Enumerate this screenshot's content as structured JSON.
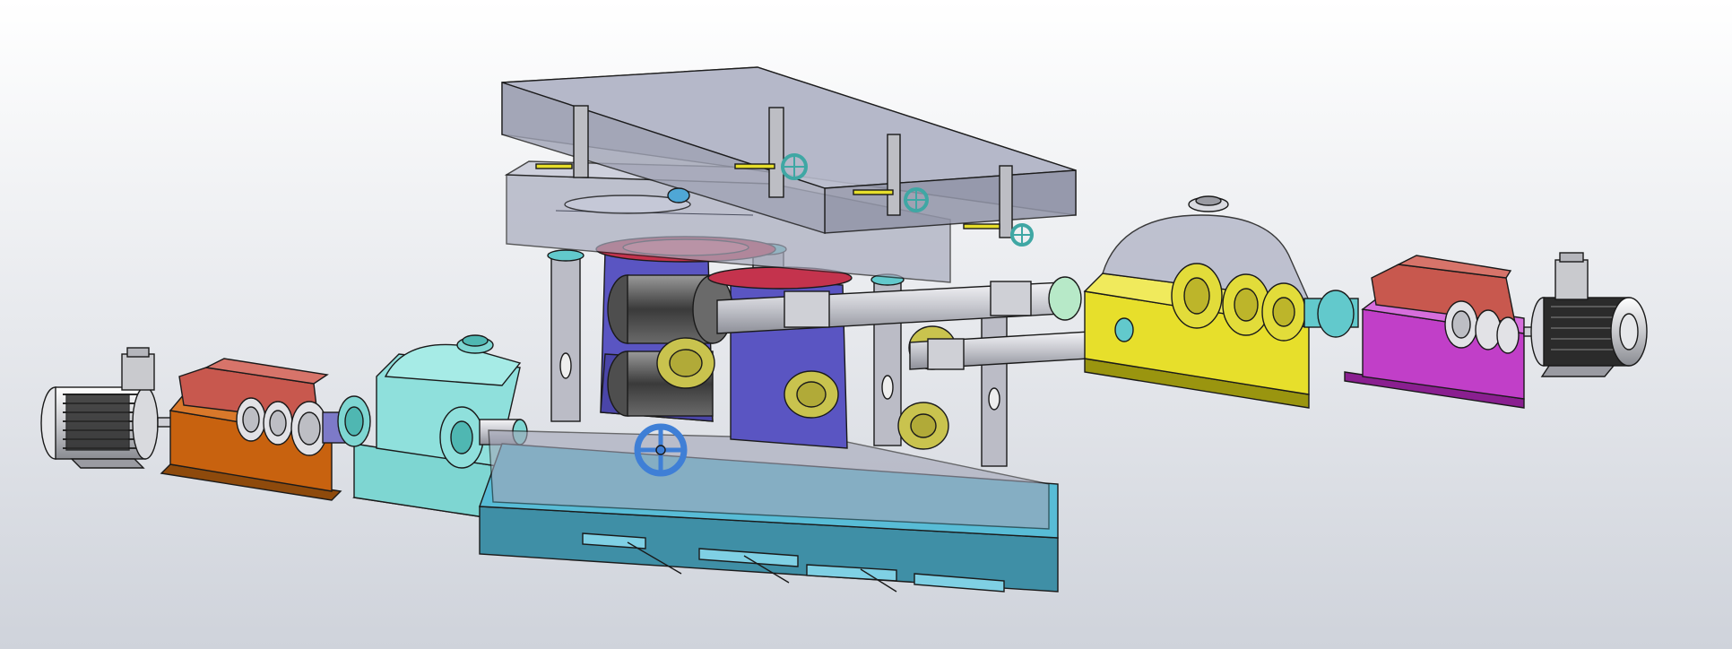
{
  "scene": {
    "background_top": "#ffffff",
    "background_bottom": "#cfd3db",
    "edge_color": "#1a1a1a"
  },
  "palette": {
    "frame_glass": "#9fa3b5",
    "frame_glass_dark": "#7b7f93",
    "base_plate": "#58bcd6",
    "base_plate_dark": "#3f8fa6",
    "reducer_cyan": "#7ed6d2",
    "reducer_orange": "#c8620f",
    "reducer_red": "#c8584e",
    "reducer_yellow": "#e7df2b",
    "reducer_magenta": "#c13fc8",
    "roll_chock_blue": "#5a55c2",
    "roll_dark": "#4e4e4e",
    "collar_olive": "#c9c34e",
    "shaft_grey": "#cfd0d6",
    "motor_grey": "#c9cace",
    "motor_black": "#2b2b2b",
    "handwheel_teal": "#3fa7a4",
    "handwheel_blue": "#3f7fd6",
    "disc_red": "#c4334d",
    "coupling_teal": "#62c9cc",
    "column_grey": "#bbbcc6"
  },
  "components": {
    "left_motor": "motor-icon",
    "left_reducer": "gearbox-icon",
    "cyan_gearbox": "gearbox-icon",
    "rolling_stand": "rolling-mill-icon",
    "yellow_gearbox": "gearbox-icon",
    "magenta_reducer": "gearbox-icon",
    "right_motor": "motor-icon",
    "handwheel": "handwheel-icon"
  }
}
